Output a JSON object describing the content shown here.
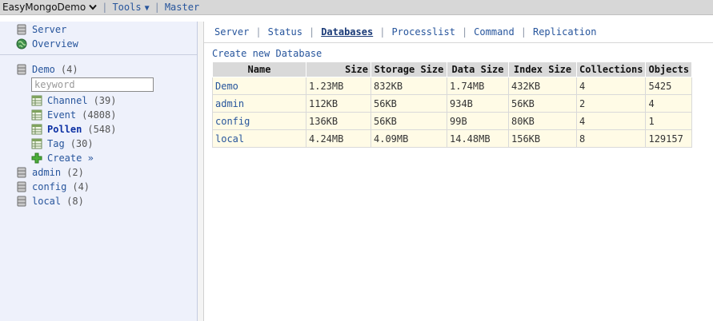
{
  "topbar": {
    "app_name": "EasyMongoDemo",
    "tools_label": "Tools",
    "master_label": "Master",
    "separator": "|"
  },
  "sidebar": {
    "top": [
      {
        "label": "Server",
        "icon": "server-icon"
      },
      {
        "label": "Overview",
        "icon": "globe-icon"
      }
    ],
    "demo": {
      "label": "Demo",
      "count": "(4)"
    },
    "search_placeholder": "keyword",
    "collections": [
      {
        "label": "Channel",
        "count": "(39)"
      },
      {
        "label": "Event",
        "count": "(4808)"
      },
      {
        "label": "Pollen",
        "count": "(548)",
        "active": true
      },
      {
        "label": "Tag",
        "count": "(30)"
      }
    ],
    "create_label": "Create »",
    "other_dbs": [
      {
        "label": "admin",
        "count": "(2)"
      },
      {
        "label": "config",
        "count": "(4)"
      },
      {
        "label": "local",
        "count": "(8)"
      }
    ]
  },
  "nav": {
    "items": [
      "Server",
      "Status",
      "Databases",
      "Processlist",
      "Command",
      "Replication"
    ],
    "current": "Databases",
    "separator": "|"
  },
  "content": {
    "create_link": "Create new Database",
    "table": {
      "headers": [
        "Name",
        "Size",
        "Storage Size",
        "Data Size",
        "Index Size",
        "Collections",
        "Objects"
      ],
      "rows": [
        [
          "Demo",
          "1.23MB",
          "832KB",
          "1.74MB",
          "432KB",
          "4",
          "5425"
        ],
        [
          "admin",
          "112KB",
          "56KB",
          "934B",
          "56KB",
          "2",
          "4"
        ],
        [
          "config",
          "136KB",
          "56KB",
          "99B",
          "80KB",
          "4",
          "1"
        ],
        [
          "local",
          "4.24MB",
          "4.09MB",
          "14.48MB",
          "156KB",
          "8",
          "129157"
        ]
      ]
    }
  },
  "colors": {
    "link": "#27559c",
    "sidebar_bg": "#eef1fb",
    "table_header_bg": "#d9d9d9",
    "table_row_bg": "#fffbe6",
    "active_collection": "#0b2fa3"
  }
}
